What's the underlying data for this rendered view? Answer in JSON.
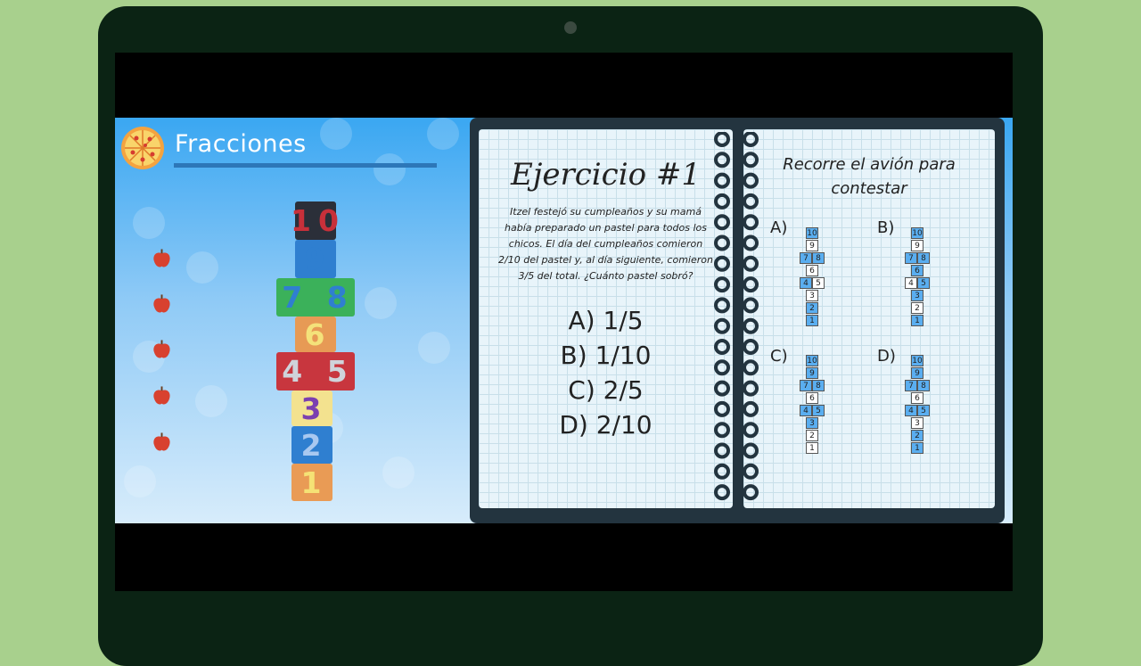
{
  "app_title": "Fracciones",
  "hopscotch": [
    {
      "label": "10",
      "color": "#c8303a",
      "bg": "#2b2f39"
    },
    {
      "label": "9",
      "color": "#2f7fd0",
      "bg": "#2f7fd0"
    },
    {
      "label": "7 8",
      "color": "#2f7fd0",
      "bg": "#3bb15a"
    },
    {
      "label": "6",
      "color": "#f4e27a",
      "bg": "#e79a55"
    },
    {
      "label": "4 5",
      "color": "#cfd3da",
      "bg": "#c8363e"
    },
    {
      "label": "3",
      "color": "#7b3fb0",
      "bg": "#f3e28f"
    },
    {
      "label": "2",
      "color": "#a8c8f0",
      "bg": "#2f7fd0"
    },
    {
      "label": "1",
      "color": "#f5e275",
      "bg": "#e99b55"
    }
  ],
  "exercise": {
    "title": "Ejercicio #1",
    "text": "Itzel festejó su cumpleaños y su mamá había preparado un pastel para todos los chicos. El día del cumpleaños comieron 2/10 del pastel y, al día siguiente, comieron 3/5 del total. ¿Cuánto pastel sobró?",
    "answers": [
      "A) 1/5",
      "B) 1/10",
      "C) 2/5",
      "D) 2/10"
    ]
  },
  "right_page": {
    "title": "Recorre el avión para contestar",
    "options": [
      {
        "label": "A)",
        "blue": [
          "10",
          "7",
          "8",
          "4",
          "2",
          "1"
        ]
      },
      {
        "label": "B)",
        "blue": [
          "10",
          "7",
          "8",
          "6",
          "5",
          "3",
          "1"
        ]
      },
      {
        "label": "C)",
        "blue": [
          "10",
          "9",
          "7",
          "8",
          "4",
          "5",
          "3"
        ]
      },
      {
        "label": "D)",
        "blue": [
          "10",
          "9",
          "7",
          "8",
          "4",
          "5",
          "2",
          "1"
        ]
      }
    ]
  },
  "colors": {
    "background": "#a8d08d",
    "device": "#0b2314",
    "notebook": "#23343f",
    "title_underline": "#2d77b8"
  }
}
